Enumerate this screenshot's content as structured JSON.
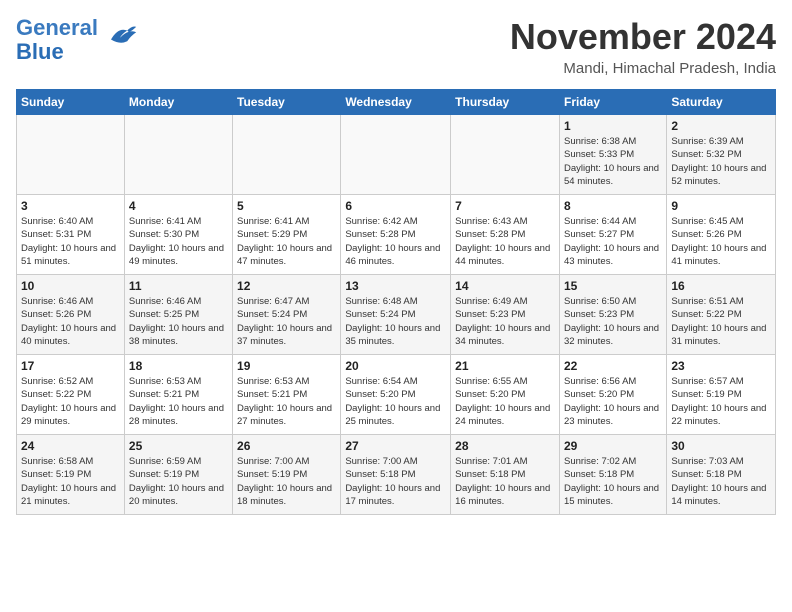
{
  "logo": {
    "line1": "General",
    "line2": "Blue"
  },
  "title": "November 2024",
  "location": "Mandi, Himachal Pradesh, India",
  "days_of_week": [
    "Sunday",
    "Monday",
    "Tuesday",
    "Wednesday",
    "Thursday",
    "Friday",
    "Saturday"
  ],
  "weeks": [
    [
      {
        "day": "",
        "info": ""
      },
      {
        "day": "",
        "info": ""
      },
      {
        "day": "",
        "info": ""
      },
      {
        "day": "",
        "info": ""
      },
      {
        "day": "",
        "info": ""
      },
      {
        "day": "1",
        "info": "Sunrise: 6:38 AM\nSunset: 5:33 PM\nDaylight: 10 hours and 54 minutes."
      },
      {
        "day": "2",
        "info": "Sunrise: 6:39 AM\nSunset: 5:32 PM\nDaylight: 10 hours and 52 minutes."
      }
    ],
    [
      {
        "day": "3",
        "info": "Sunrise: 6:40 AM\nSunset: 5:31 PM\nDaylight: 10 hours and 51 minutes."
      },
      {
        "day": "4",
        "info": "Sunrise: 6:41 AM\nSunset: 5:30 PM\nDaylight: 10 hours and 49 minutes."
      },
      {
        "day": "5",
        "info": "Sunrise: 6:41 AM\nSunset: 5:29 PM\nDaylight: 10 hours and 47 minutes."
      },
      {
        "day": "6",
        "info": "Sunrise: 6:42 AM\nSunset: 5:28 PM\nDaylight: 10 hours and 46 minutes."
      },
      {
        "day": "7",
        "info": "Sunrise: 6:43 AM\nSunset: 5:28 PM\nDaylight: 10 hours and 44 minutes."
      },
      {
        "day": "8",
        "info": "Sunrise: 6:44 AM\nSunset: 5:27 PM\nDaylight: 10 hours and 43 minutes."
      },
      {
        "day": "9",
        "info": "Sunrise: 6:45 AM\nSunset: 5:26 PM\nDaylight: 10 hours and 41 minutes."
      }
    ],
    [
      {
        "day": "10",
        "info": "Sunrise: 6:46 AM\nSunset: 5:26 PM\nDaylight: 10 hours and 40 minutes."
      },
      {
        "day": "11",
        "info": "Sunrise: 6:46 AM\nSunset: 5:25 PM\nDaylight: 10 hours and 38 minutes."
      },
      {
        "day": "12",
        "info": "Sunrise: 6:47 AM\nSunset: 5:24 PM\nDaylight: 10 hours and 37 minutes."
      },
      {
        "day": "13",
        "info": "Sunrise: 6:48 AM\nSunset: 5:24 PM\nDaylight: 10 hours and 35 minutes."
      },
      {
        "day": "14",
        "info": "Sunrise: 6:49 AM\nSunset: 5:23 PM\nDaylight: 10 hours and 34 minutes."
      },
      {
        "day": "15",
        "info": "Sunrise: 6:50 AM\nSunset: 5:23 PM\nDaylight: 10 hours and 32 minutes."
      },
      {
        "day": "16",
        "info": "Sunrise: 6:51 AM\nSunset: 5:22 PM\nDaylight: 10 hours and 31 minutes."
      }
    ],
    [
      {
        "day": "17",
        "info": "Sunrise: 6:52 AM\nSunset: 5:22 PM\nDaylight: 10 hours and 29 minutes."
      },
      {
        "day": "18",
        "info": "Sunrise: 6:53 AM\nSunset: 5:21 PM\nDaylight: 10 hours and 28 minutes."
      },
      {
        "day": "19",
        "info": "Sunrise: 6:53 AM\nSunset: 5:21 PM\nDaylight: 10 hours and 27 minutes."
      },
      {
        "day": "20",
        "info": "Sunrise: 6:54 AM\nSunset: 5:20 PM\nDaylight: 10 hours and 25 minutes."
      },
      {
        "day": "21",
        "info": "Sunrise: 6:55 AM\nSunset: 5:20 PM\nDaylight: 10 hours and 24 minutes."
      },
      {
        "day": "22",
        "info": "Sunrise: 6:56 AM\nSunset: 5:20 PM\nDaylight: 10 hours and 23 minutes."
      },
      {
        "day": "23",
        "info": "Sunrise: 6:57 AM\nSunset: 5:19 PM\nDaylight: 10 hours and 22 minutes."
      }
    ],
    [
      {
        "day": "24",
        "info": "Sunrise: 6:58 AM\nSunset: 5:19 PM\nDaylight: 10 hours and 21 minutes."
      },
      {
        "day": "25",
        "info": "Sunrise: 6:59 AM\nSunset: 5:19 PM\nDaylight: 10 hours and 20 minutes."
      },
      {
        "day": "26",
        "info": "Sunrise: 7:00 AM\nSunset: 5:19 PM\nDaylight: 10 hours and 18 minutes."
      },
      {
        "day": "27",
        "info": "Sunrise: 7:00 AM\nSunset: 5:18 PM\nDaylight: 10 hours and 17 minutes."
      },
      {
        "day": "28",
        "info": "Sunrise: 7:01 AM\nSunset: 5:18 PM\nDaylight: 10 hours and 16 minutes."
      },
      {
        "day": "29",
        "info": "Sunrise: 7:02 AM\nSunset: 5:18 PM\nDaylight: 10 hours and 15 minutes."
      },
      {
        "day": "30",
        "info": "Sunrise: 7:03 AM\nSunset: 5:18 PM\nDaylight: 10 hours and 14 minutes."
      }
    ]
  ]
}
